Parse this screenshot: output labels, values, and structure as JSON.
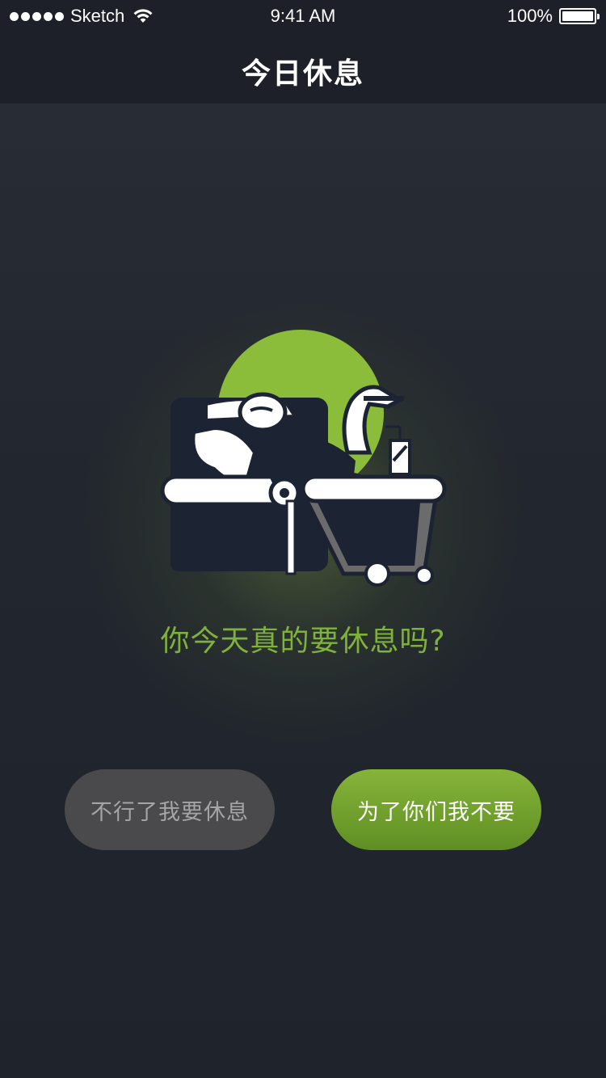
{
  "status_bar": {
    "carrier": "Sketch",
    "time": "9:41 AM",
    "battery": "100%"
  },
  "nav": {
    "title": "今日休息"
  },
  "main": {
    "question": "你今天真的要休息吗?",
    "rest_button": "不行了我要休息",
    "stay_button": "为了你们我不要"
  },
  "colors": {
    "accent": "#7fb23a",
    "background": "#20242d",
    "nav_background": "#1d2028",
    "rest_button": "#4a4a4c",
    "stay_button": "#6fa02c"
  },
  "icons": [
    "signal-dots-icon",
    "wifi-icon",
    "battery-icon",
    "lazy-person-on-sofa-illustration"
  ]
}
